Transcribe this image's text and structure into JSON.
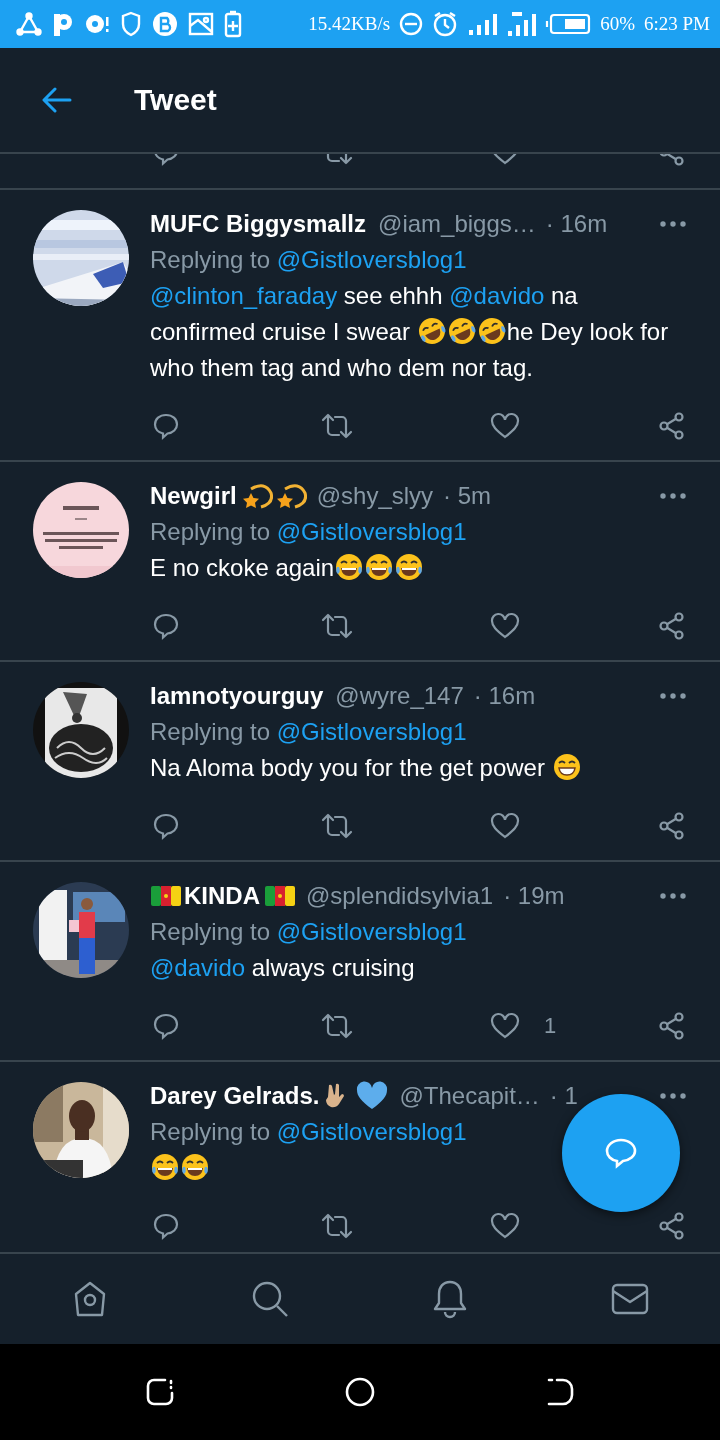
{
  "status_bar": {
    "speed": "15.42KB/s",
    "battery": "60%",
    "time": "6:23 PM"
  },
  "header": {
    "title": "Tweet"
  },
  "tweets": [
    {
      "name": [
        {
          "kind": "text",
          "text": "MUFC Biggysmallz"
        }
      ],
      "handle": "@iam_biggs…",
      "time": "· 16m",
      "replying_label": "Replying to",
      "replying_to": "@Gistloversblog1",
      "body": [
        {
          "kind": "mention",
          "text": "@clinton_faraday"
        },
        {
          "kind": "text",
          "text": " see ehhh "
        },
        {
          "kind": "mention",
          "text": "@davido"
        },
        {
          "kind": "text",
          "text": " na confirmed cruise I swear "
        },
        {
          "kind": "rofl"
        },
        {
          "kind": "rofl"
        },
        {
          "kind": "rofl"
        },
        {
          "kind": "text",
          "text": "he Dey look for who them tag and who dem nor tag."
        }
      ]
    },
    {
      "name": [
        {
          "kind": "text",
          "text": "Newgirl"
        },
        {
          "kind": "shooting-star"
        },
        {
          "kind": "shooting-star"
        }
      ],
      "handle": "@shy_slyy",
      "time": "· 5m",
      "replying_label": "Replying to",
      "replying_to": "@Gistloversblog1",
      "body": [
        {
          "kind": "text",
          "text": "E no ckoke again"
        },
        {
          "kind": "joy"
        },
        {
          "kind": "joy"
        },
        {
          "kind": "joy"
        }
      ]
    },
    {
      "name": [
        {
          "kind": "text",
          "text": "Iamnotyourguy"
        }
      ],
      "handle": "@wyre_147",
      "time": "· 16m",
      "replying_label": "Replying to",
      "replying_to": "@Gistloversblog1",
      "body": [
        {
          "kind": "text",
          "text": "Na Aloma body you for the get power "
        },
        {
          "kind": "grin"
        }
      ]
    },
    {
      "name": [
        {
          "kind": "flag"
        },
        {
          "kind": "text",
          "text": "KINDA"
        },
        {
          "kind": "flag"
        }
      ],
      "handle": "@splendidsylvia1",
      "time": "· 19m",
      "replying_label": "Replying to",
      "replying_to": "@Gistloversblog1",
      "body": [
        {
          "kind": "mention",
          "text": "@davido"
        },
        {
          "kind": "text",
          "text": " always cruising"
        }
      ],
      "like_count": "1"
    },
    {
      "name": [
        {
          "kind": "text",
          "text": "Darey Gelrads."
        },
        {
          "kind": "rock-hand"
        },
        {
          "kind": "blue-heart"
        }
      ],
      "handle": "@Thecapit…",
      "time": "· 1",
      "replying_label": "Replying to",
      "replying_to": "@Gistloversblog1",
      "body": [
        {
          "kind": "joy"
        },
        {
          "kind": "joy"
        }
      ]
    }
  ]
}
